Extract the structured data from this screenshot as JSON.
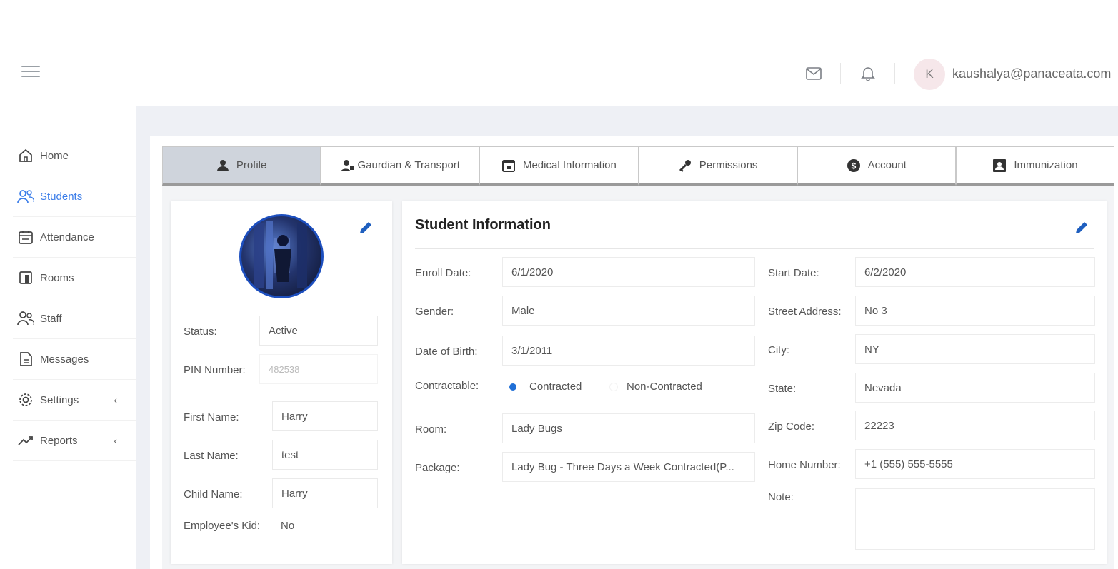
{
  "header": {
    "user_initial": "K",
    "user_email": "kaushalya@panaceata.com"
  },
  "sidebar": {
    "items": [
      {
        "label": "Home",
        "icon": "home-icon"
      },
      {
        "label": "Students",
        "icon": "users-icon",
        "active": true
      },
      {
        "label": "Attendance",
        "icon": "calendar-icon"
      },
      {
        "label": "Rooms",
        "icon": "door-icon"
      },
      {
        "label": "Staff",
        "icon": "staff-icon"
      },
      {
        "label": "Messages",
        "icon": "document-icon"
      },
      {
        "label": "Settings",
        "icon": "gear-icon",
        "chevron": "‹"
      },
      {
        "label": "Reports",
        "icon": "trend-icon",
        "chevron": "‹"
      }
    ]
  },
  "tabs": [
    {
      "label": "Profile",
      "icon": "user-icon",
      "active": true
    },
    {
      "label": "Gaurdian & Transport",
      "icon": "guardian-icon"
    },
    {
      "label": "Medical Information",
      "icon": "calendar-icon"
    },
    {
      "label": "Permissions",
      "icon": "key-icon"
    },
    {
      "label": "Account",
      "icon": "dollar-icon"
    },
    {
      "label": "Immunization",
      "icon": "id-card-icon"
    }
  ],
  "profile": {
    "status_label": "Status:",
    "status_value": "Active",
    "pin_label": "PIN Number:",
    "pin_value": "482538",
    "first_name_label": "First Name:",
    "first_name_value": "Harry",
    "last_name_label": "Last Name:",
    "last_name_value": "test",
    "child_name_label": "Child Name:",
    "child_name_value": "Harry",
    "employee_kid_label": "Employee's Kid:",
    "employee_kid_value": "No"
  },
  "student_info": {
    "title": "Student Information",
    "enroll_date_label": "Enroll Date:",
    "enroll_date_value": "6/1/2020",
    "gender_label": "Gender:",
    "gender_value": "Male",
    "dob_label": "Date of Birth:",
    "dob_value": "3/1/2011",
    "contractable_label": "Contractable:",
    "contracted_label": "Contracted",
    "non_contracted_label": "Non-Contracted",
    "room_label": "Room:",
    "room_value": "Lady Bugs",
    "package_label": "Package:",
    "package_value": "Lady Bug - Three Days a Week Contracted(P...",
    "start_date_label": "Start Date:",
    "start_date_value": "6/2/2020",
    "street_label": "Street Address:",
    "street_value": "No 3",
    "city_label": "City:",
    "city_value": "NY",
    "state_label": "State:",
    "state_value": "Nevada",
    "zip_label": "Zip Code:",
    "zip_value": "22223",
    "home_number_label": "Home Number:",
    "home_number_value": "+1 (555) 555-5555",
    "note_label": "Note:",
    "note_value": ""
  },
  "colors": {
    "accent": "#3b7de9",
    "radio_selected": "#1f6fd6",
    "edit_icon": "#1f5fbf"
  }
}
